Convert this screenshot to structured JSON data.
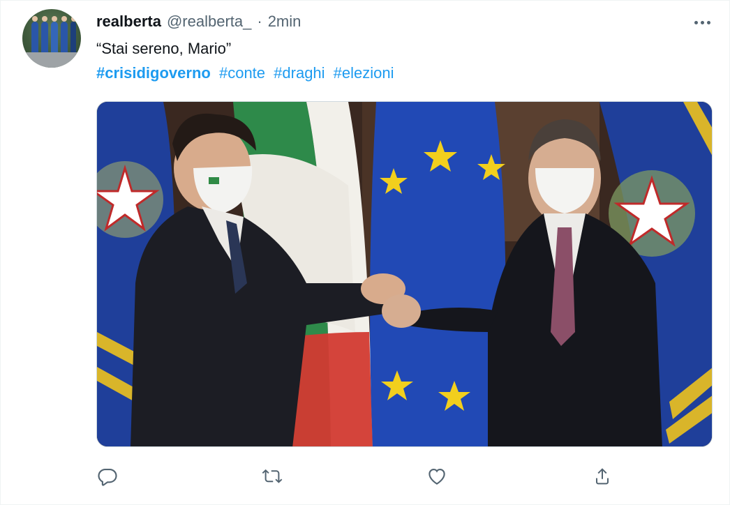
{
  "user": {
    "display_name": "realberta",
    "handle": "@realberta_",
    "separator": "·",
    "time": "2min"
  },
  "tweet": {
    "text": "“Stai sereno, Mario”",
    "hashtags": [
      "#crisidigoverno",
      "#conte",
      "#draghi",
      "#elezioni"
    ]
  },
  "media": {
    "type": "photo"
  },
  "icons": {
    "more": "more-horizontal-icon",
    "reply": "reply-icon",
    "retweet": "retweet-icon",
    "like": "heart-icon",
    "share": "share-icon"
  },
  "colors": {
    "text": "#0f1419",
    "secondary": "#536471",
    "link": "#1d9bf0",
    "border": "#cfd9de"
  }
}
